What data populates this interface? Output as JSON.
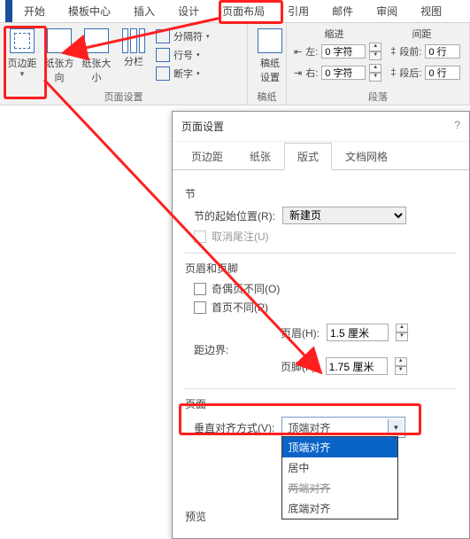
{
  "ribbon_tabs": {
    "start": "开始",
    "template": "模板中心",
    "insert": "插入",
    "design": "设计",
    "layout": "页面布局",
    "reference": "引用",
    "mail": "邮件",
    "review": "审阅",
    "view": "视图"
  },
  "page_setup_group": {
    "title": "页面设置",
    "margins": "页边距",
    "orientation": "纸张方向",
    "size": "纸张大小",
    "columns": "分栏",
    "separator": "分隔符",
    "line_numbers": "行号",
    "hyphenation": "断字"
  },
  "gaoben_group": {
    "title": "稿纸",
    "label": "稿纸\n设置"
  },
  "indent_group": {
    "title_left": "缩进",
    "title_right": "间距",
    "left_label": "左:",
    "right_label": "右:",
    "before_label": "段前:",
    "after_label": "段后:",
    "val_left": "0 字符",
    "val_right": "0 字符",
    "val_before": "0 行",
    "val_after": "0 行",
    "group_title": "段落"
  },
  "dialog": {
    "title": "页面设置",
    "tabs": {
      "margins": "页边距",
      "paper": "纸张",
      "layout": "版式",
      "grid": "文档网格"
    },
    "section": {
      "heading": "节",
      "start_label": "节的起始位置(R):",
      "start_value": "新建页",
      "suppress_endnotes": "取消尾注(U)"
    },
    "headers": {
      "heading": "页眉和页脚",
      "odd_even": "奇偶页不同(O)",
      "first_page": "首页不同(P)",
      "distance_label": "距边界:",
      "header_label": "页眉(H):",
      "header_value": "1.5 厘米",
      "footer_label": "页脚(F):",
      "footer_value": "1.75 厘米"
    },
    "page": {
      "heading": "页面",
      "valign_label": "垂直对齐方式(V):",
      "valign_value": "顶端对齐",
      "options": {
        "top": "顶端对齐",
        "center": "居中",
        "justify": "两端对齐",
        "bottom": "底端对齐"
      }
    },
    "preview": "预览"
  }
}
